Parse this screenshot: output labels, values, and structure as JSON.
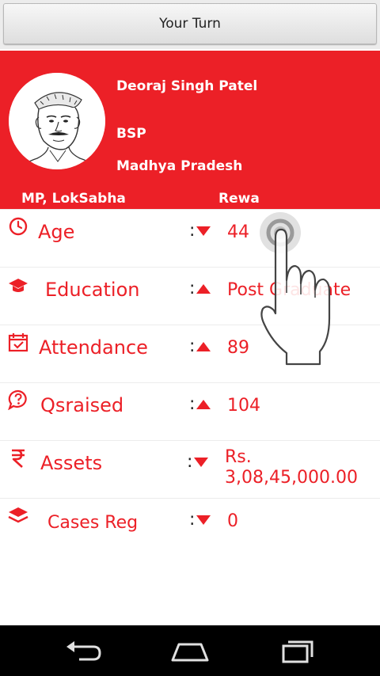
{
  "header": {
    "turn_button_label": "Your Turn"
  },
  "profile": {
    "name": "Deoraj Singh Patel",
    "party": "BSP",
    "state": "Madhya Pradesh",
    "house": "MP, LokSabha",
    "constituency": "Rewa"
  },
  "stats": [
    {
      "label": "Age",
      "icon": "clock-icon",
      "trend": "down",
      "value": "44"
    },
    {
      "label": "Education",
      "icon": "graduation-cap-icon",
      "trend": "up",
      "value": "Post Graduate"
    },
    {
      "label": "Attendance",
      "icon": "calendar-check-icon",
      "trend": "up",
      "value": "89"
    },
    {
      "label": "Qsraised",
      "icon": "question-bubble-icon",
      "trend": "up",
      "value": "104"
    },
    {
      "label": "Assets",
      "icon": "rupee-icon",
      "trend": "down",
      "value": "Rs. 3,08,45,000.00"
    },
    {
      "label": "Cases Reg",
      "icon": "layers-icon",
      "trend": "down",
      "value": "0"
    }
  ],
  "colors": {
    "accent": "#ec2027",
    "navbar": "#000000",
    "button_bg": "#e6e6e6"
  },
  "navbar": {
    "buttons": [
      "back-icon",
      "home-icon",
      "recents-icon"
    ]
  }
}
